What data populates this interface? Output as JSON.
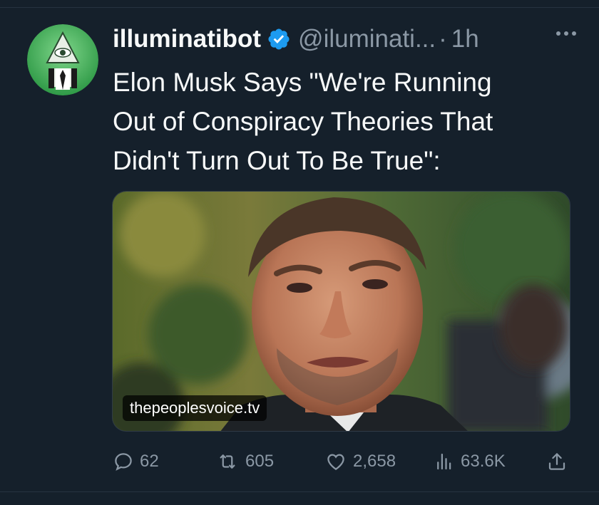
{
  "tweet": {
    "display_name": "illuminatibot",
    "handle": "@iluminati...",
    "separator": "·",
    "time": "1h",
    "text_lines": [
      "Elon Musk Says \"We're Running",
      "Out of Conspiracy Theories That",
      "Didn't Turn Out To Be True\":"
    ],
    "media_link": "thepeoplesvoice.tv"
  },
  "actions": {
    "replies": "62",
    "retweets": "605",
    "likes": "2,658",
    "views": "63.6K"
  },
  "icons": {
    "verified": "verified-badge-icon",
    "more": "more-options-icon",
    "reply": "reply-icon",
    "retweet": "retweet-icon",
    "like": "heart-icon",
    "views": "views-chart-icon",
    "share": "share-icon"
  },
  "colors": {
    "background": "#15202b",
    "primary_text": "#f7f9f9",
    "secondary_text": "#8b98a5",
    "verified_blue": "#1d9bf0",
    "avatar_green": "#49b060"
  }
}
